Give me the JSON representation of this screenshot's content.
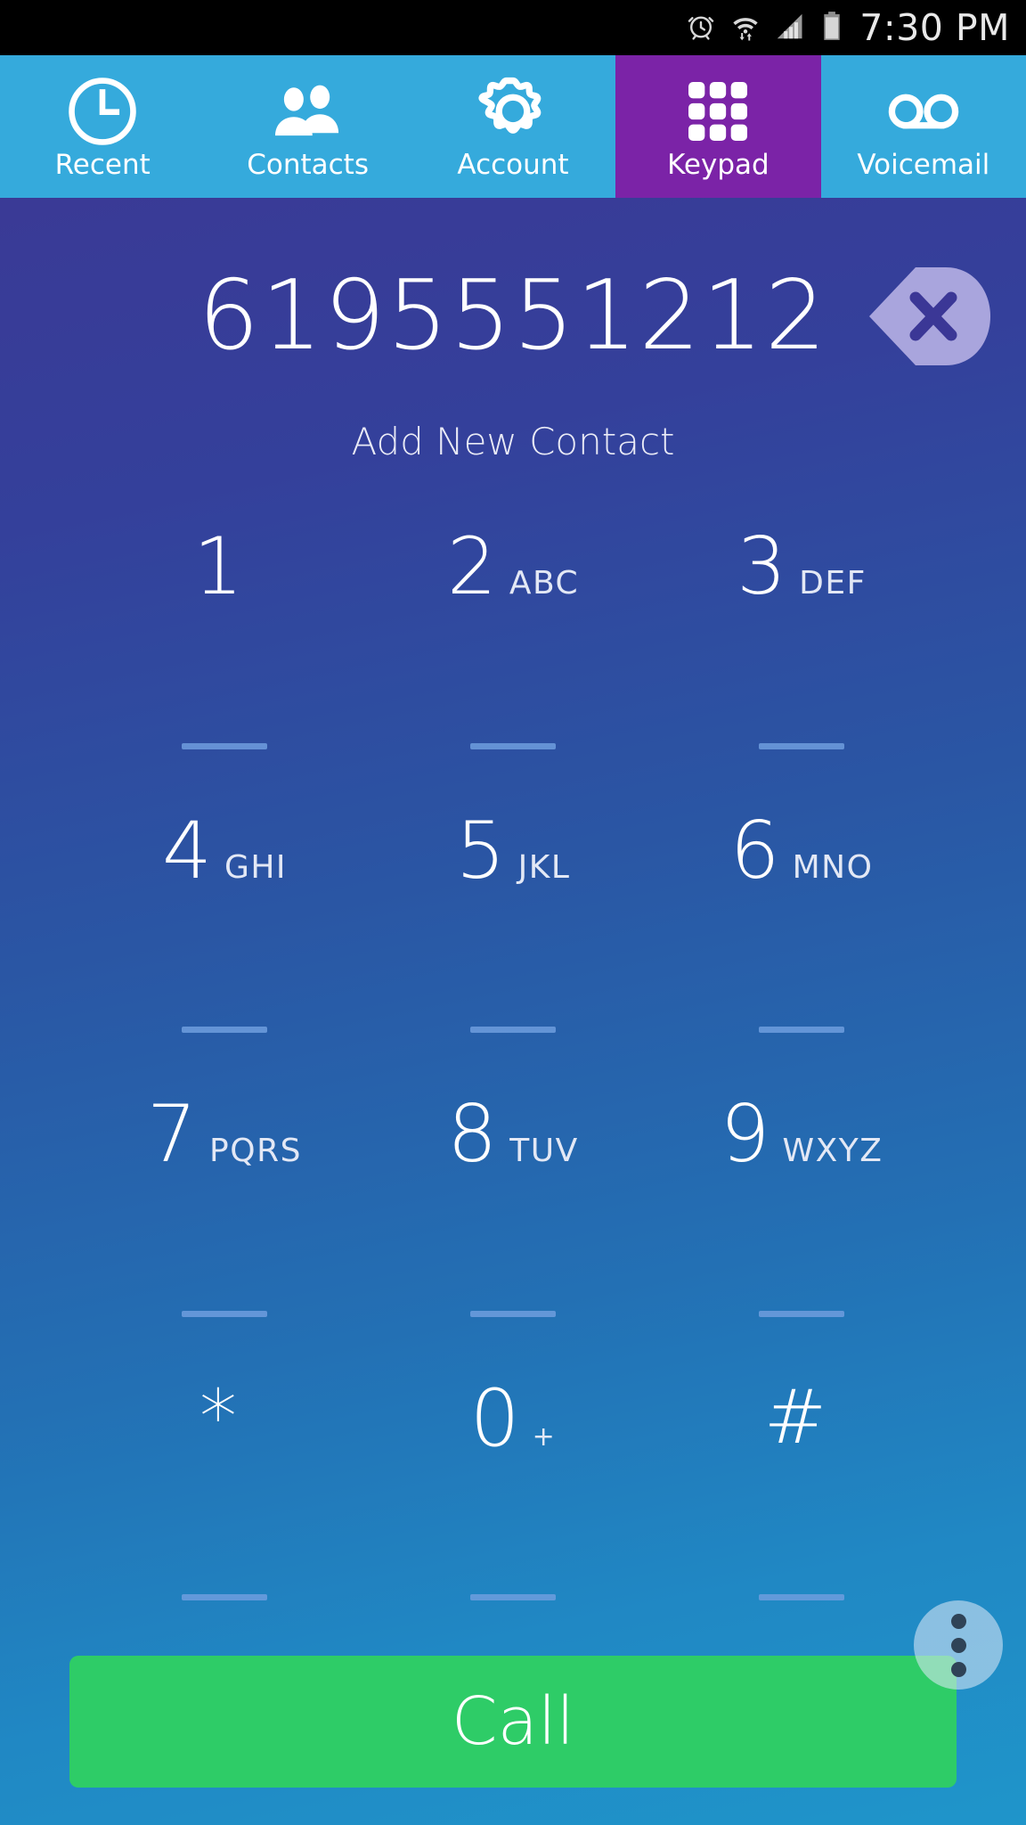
{
  "statusbar": {
    "time": "7:30 PM",
    "icons": [
      "alarm-clock-icon",
      "wifi-icon",
      "signal-bars-icon",
      "battery-icon"
    ]
  },
  "tabs": [
    {
      "label": "Recent",
      "icon": "clock-icon",
      "active": false
    },
    {
      "label": "Contacts",
      "icon": "contacts-icon",
      "active": false
    },
    {
      "label": "Account",
      "icon": "gear-icon",
      "active": false
    },
    {
      "label": "Keypad",
      "icon": "keypad-grid-icon",
      "active": true
    },
    {
      "label": "Voicemail",
      "icon": "voicemail-icon",
      "active": false
    }
  ],
  "dialer": {
    "number": "6195551212",
    "backspace_icon": "backspace-x-icon",
    "add_contact_label": "Add New Contact"
  },
  "keypad": [
    {
      "digit": "1",
      "letters": ""
    },
    {
      "digit": "2",
      "letters": "ABC"
    },
    {
      "digit": "3",
      "letters": "DEF"
    },
    {
      "digit": "4",
      "letters": "GHI"
    },
    {
      "digit": "5",
      "letters": "JKL"
    },
    {
      "digit": "6",
      "letters": "MNO"
    },
    {
      "digit": "7",
      "letters": "PQRS"
    },
    {
      "digit": "8",
      "letters": "TUV"
    },
    {
      "digit": "9",
      "letters": "WXYZ"
    },
    {
      "digit": "*",
      "letters": ""
    },
    {
      "digit": "0",
      "letters": "+"
    },
    {
      "digit": "#",
      "letters": ""
    }
  ],
  "fab": {
    "icon": "overflow-menu-icon"
  },
  "call": {
    "label": "Call"
  },
  "colors": {
    "tab_bar": "#35aadc",
    "tab_active": "#7b23a7",
    "call_button": "#2ecc67",
    "gradient_top": "#3a3a96",
    "gradient_bottom": "#1f95ca",
    "key_underline": "#6f9ede"
  }
}
